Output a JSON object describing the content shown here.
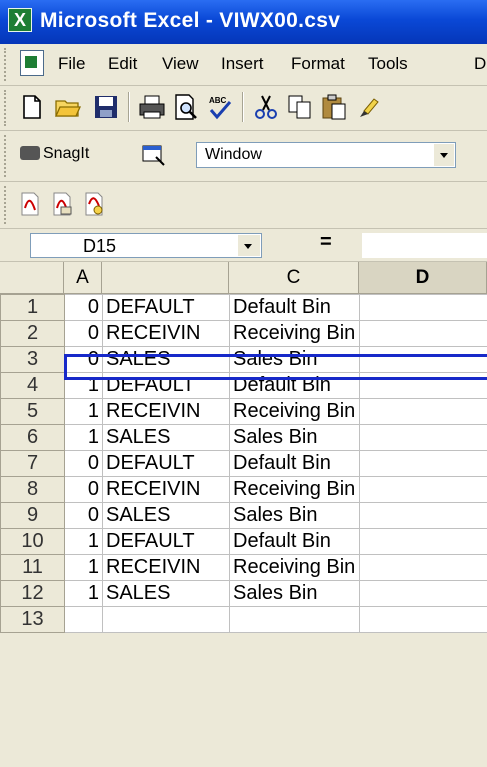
{
  "window": {
    "title": "Microsoft Excel - VIWX00.csv"
  },
  "menu": [
    "File",
    "Edit",
    "View",
    "Insert",
    "Format",
    "Tools",
    "D"
  ],
  "snagit": {
    "label": "SnagIt",
    "combo_value": "Window"
  },
  "formula_bar": {
    "name_box": "D15",
    "equals": "=",
    "formula": ""
  },
  "columns": [
    "A",
    "",
    "C",
    "D"
  ],
  "rows": [
    {
      "n": "1",
      "a": "0",
      "b": "DEFAULT",
      "c": "Default Bin"
    },
    {
      "n": "2",
      "a": "0",
      "b": "RECEIVIN",
      "c": "Receiving Bin"
    },
    {
      "n": "3",
      "a": "0",
      "b": "SALES",
      "c": "Sales Bin"
    },
    {
      "n": "4",
      "a": "1",
      "b": "DEFAULT",
      "c": "Default Bin"
    },
    {
      "n": "5",
      "a": "1",
      "b": "RECEIVIN",
      "c": "Receiving Bin"
    },
    {
      "n": "6",
      "a": "1",
      "b": "SALES",
      "c": "Sales Bin"
    },
    {
      "n": "7",
      "a": "0",
      "b": "DEFAULT",
      "c": "Default Bin"
    },
    {
      "n": "8",
      "a": "0",
      "b": "RECEIVIN",
      "c": "Receiving Bin"
    },
    {
      "n": "9",
      "a": "0",
      "b": "SALES",
      "c": "Sales Bin"
    },
    {
      "n": "10",
      "a": "1",
      "b": "DEFAULT",
      "c": "Default Bin"
    },
    {
      "n": "11",
      "a": "1",
      "b": "RECEIVIN",
      "c": "Receiving Bin"
    },
    {
      "n": "12",
      "a": "1",
      "b": "SALES",
      "c": "Sales Bin"
    },
    {
      "n": "13",
      "a": "",
      "b": "",
      "c": ""
    }
  ],
  "colors": {
    "title_bar": "#0a48d6",
    "highlight_box": "#1729c9"
  }
}
